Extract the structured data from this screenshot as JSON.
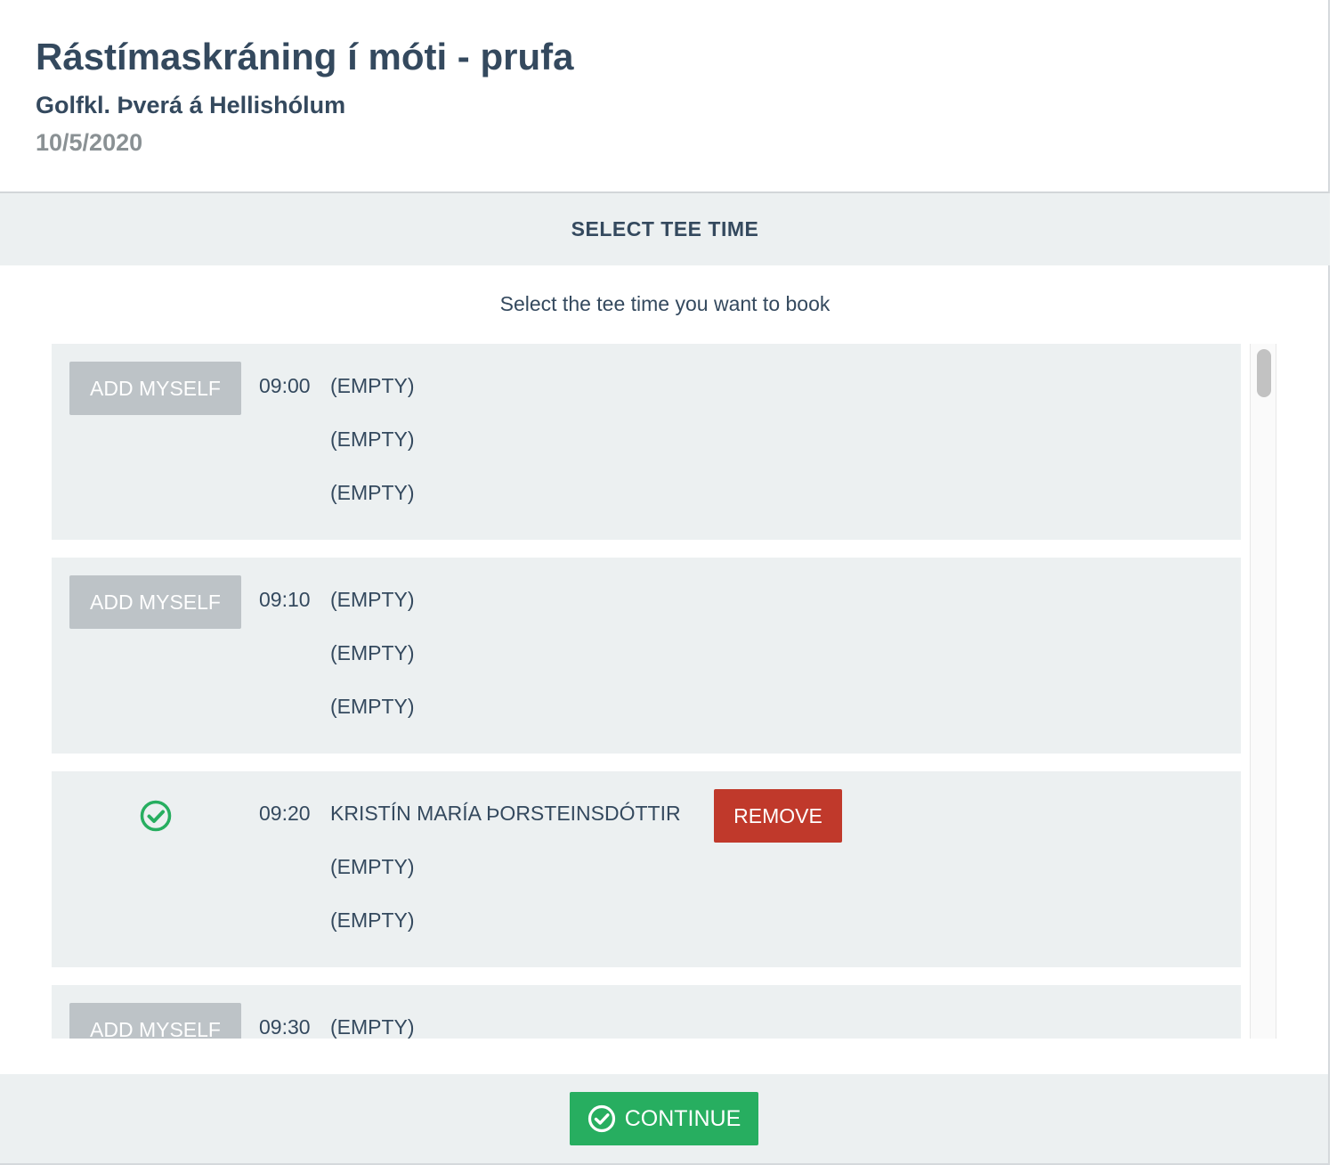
{
  "header": {
    "title": "Rástímaskráning í móti - prufa",
    "club": "Golfkl. Þverá á Hellishólum",
    "date": "10/5/2020"
  },
  "section": {
    "title": "SELECT TEE TIME",
    "instruction": "Select the tee time you want to book"
  },
  "colors": {
    "accent_green": "#27ae60",
    "remove_red": "#c0392b",
    "disabled_gray": "#bdc3c7",
    "text_dark": "#34495e",
    "panel_bg": "#ecf0f1"
  },
  "slots": [
    {
      "time": "09:00",
      "action_label": "ADD MYSELF",
      "players": [
        "(EMPTY)",
        "(EMPTY)",
        "(EMPTY)"
      ]
    },
    {
      "time": "09:10",
      "action_label": "ADD MYSELF",
      "players": [
        "(EMPTY)",
        "(EMPTY)",
        "(EMPTY)"
      ]
    },
    {
      "time": "09:20",
      "selected_icon": "check-circle-icon",
      "players": [
        "KRISTÍN MARÍA ÞORSTEINSDÓTTIR",
        "(EMPTY)",
        "(EMPTY)"
      ],
      "remove_label": "REMOVE"
    },
    {
      "time": "09:30",
      "action_label": "ADD MYSELF",
      "players": [
        "(EMPTY)"
      ]
    }
  ],
  "footer": {
    "continue_label": "CONTINUE",
    "continue_icon": "check-circle-icon"
  }
}
